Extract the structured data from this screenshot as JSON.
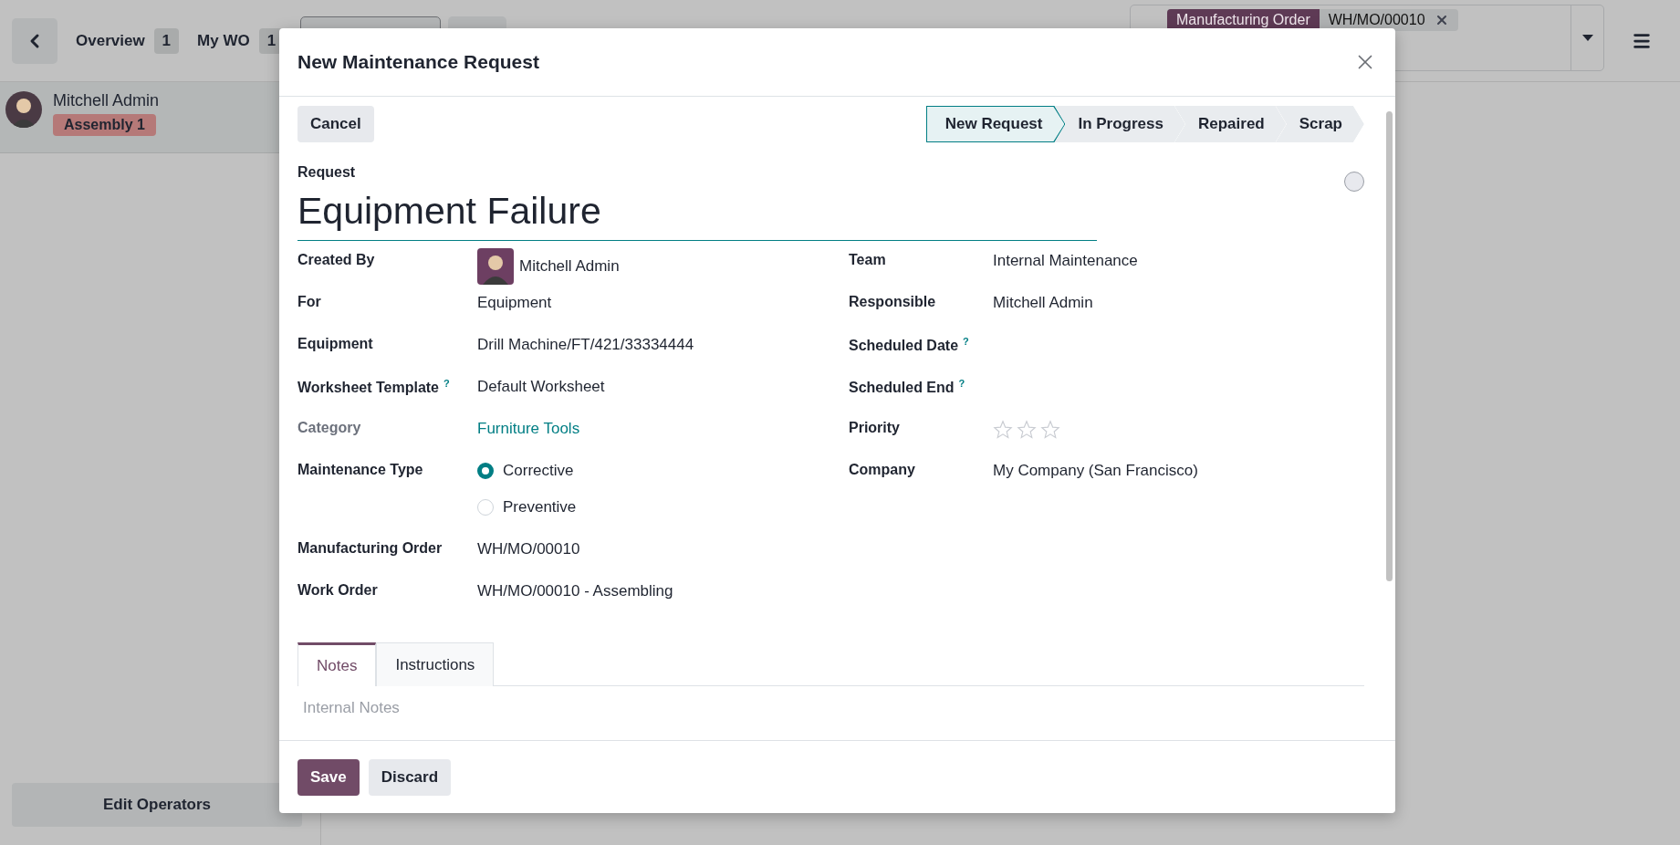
{
  "background": {
    "nav_items": [
      {
        "label": "Overview",
        "count": "1"
      },
      {
        "label": "My WO",
        "count": "1"
      }
    ],
    "filter_facet": {
      "label": "Manufacturing Order",
      "value": "WH/MO/00010"
    },
    "operator": {
      "name": "Mitchell Admin",
      "workcenter": "Assembly 1"
    },
    "edit_operators_button": "Edit Operators"
  },
  "dialog": {
    "title": "New Maintenance Request",
    "cancel_button": "Cancel",
    "stages": [
      {
        "label": "New Request",
        "selected": true
      },
      {
        "label": "In Progress",
        "selected": false
      },
      {
        "label": "Repaired",
        "selected": false
      },
      {
        "label": "Scrap",
        "selected": false
      }
    ],
    "request_label": "Request",
    "request_title": "Equipment Failure",
    "left_fields": [
      {
        "kind": "avatar",
        "label": "Created By",
        "value": "Mitchell Admin",
        "muted": false
      },
      {
        "kind": "text",
        "label": "For",
        "value": "Equipment",
        "muted": false
      },
      {
        "kind": "text",
        "label": "Equipment",
        "value": "Drill Machine/FT/421/33334444",
        "muted": false
      },
      {
        "kind": "text",
        "label": "Worksheet Template",
        "help": "?",
        "value": "Default Worksheet",
        "muted": false
      },
      {
        "kind": "link",
        "label": "Category",
        "value": "Furniture Tools",
        "muted": true
      },
      {
        "kind": "radio",
        "label": "Maintenance Type",
        "muted": false,
        "options": [
          {
            "label": "Corrective",
            "selected": true
          },
          {
            "label": "Preventive",
            "selected": false
          }
        ]
      },
      {
        "kind": "text",
        "label": "Manufacturing Order",
        "value": "WH/MO/00010",
        "muted": false
      },
      {
        "kind": "text",
        "label": "Work Order",
        "value": "WH/MO/00010 - Assembling",
        "muted": false
      }
    ],
    "right_fields": [
      {
        "kind": "text",
        "label": "Team",
        "value": "Internal Maintenance",
        "muted": false
      },
      {
        "kind": "text",
        "label": "Responsible",
        "value": "Mitchell Admin",
        "muted": false
      },
      {
        "kind": "text",
        "label": "Scheduled Date",
        "help": "?",
        "muted": false
      },
      {
        "kind": "text",
        "label": "Scheduled End",
        "help": "?",
        "muted": false
      },
      {
        "kind": "stars",
        "label": "Priority",
        "stars": 0,
        "muted": false
      },
      {
        "kind": "text",
        "label": "Company",
        "value": "My Company (San Francisco)",
        "muted": false
      }
    ],
    "tabs": [
      {
        "label": "Notes",
        "selected": true
      },
      {
        "label": "Instructions",
        "selected": false
      }
    ],
    "notes": {
      "placeholder": "Internal Notes"
    },
    "buttons": [
      {
        "label": "Save",
        "kind": "primary"
      },
      {
        "label": "Discard",
        "kind": "secondary"
      }
    ]
  }
}
